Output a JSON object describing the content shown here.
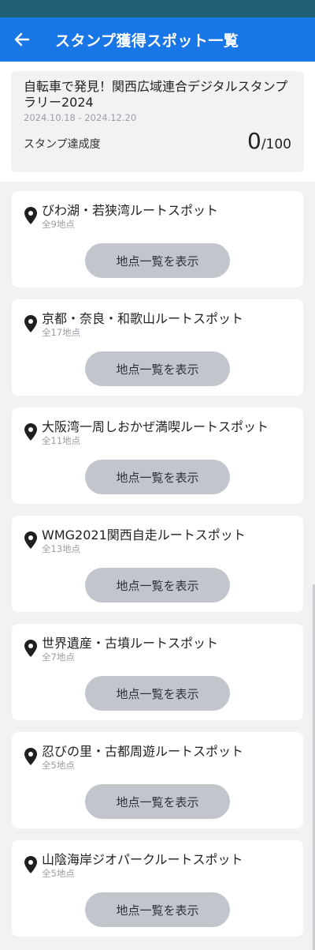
{
  "appbar": {
    "title": "スタンプ獲得スポット一覧"
  },
  "event": {
    "title": "自転車で発見！関西広域連合デジタルスタンプラリー2024",
    "dates": "2024.10.18 - 2024.12.20",
    "progress_label": "スタンプ達成度",
    "progress_current": "0",
    "progress_sep": "/",
    "progress_total": "100"
  },
  "routes": [
    {
      "name": "びわ湖・若狭湾ルートスポット",
      "count": "全9地点",
      "button": "地点一覧を表示"
    },
    {
      "name": "京都・奈良・和歌山ルートスポット",
      "count": "全17地点",
      "button": "地点一覧を表示"
    },
    {
      "name": "大阪湾一周しおかぜ満喫ルートスポット",
      "count": "全11地点",
      "button": "地点一覧を表示"
    },
    {
      "name": "WMG2021関西自走ルートスポット",
      "count": "全13地点",
      "button": "地点一覧を表示"
    },
    {
      "name": "世界遺産・古墳ルートスポット",
      "count": "全7地点",
      "button": "地点一覧を表示"
    },
    {
      "name": "忍びの里・古都周遊ルートスポット",
      "count": "全5地点",
      "button": "地点一覧を表示"
    },
    {
      "name": "山陰海岸ジオパークルートスポット",
      "count": "全5地点",
      "button": "地点一覧を表示"
    }
  ],
  "icons": {
    "back": "arrow-left-icon",
    "pin": "location-pin-icon"
  },
  "colors": {
    "appbar": "#1976e6",
    "statusbar": "#1f5f73",
    "button": "#c2c6cc",
    "background": "#f1f2f4"
  }
}
